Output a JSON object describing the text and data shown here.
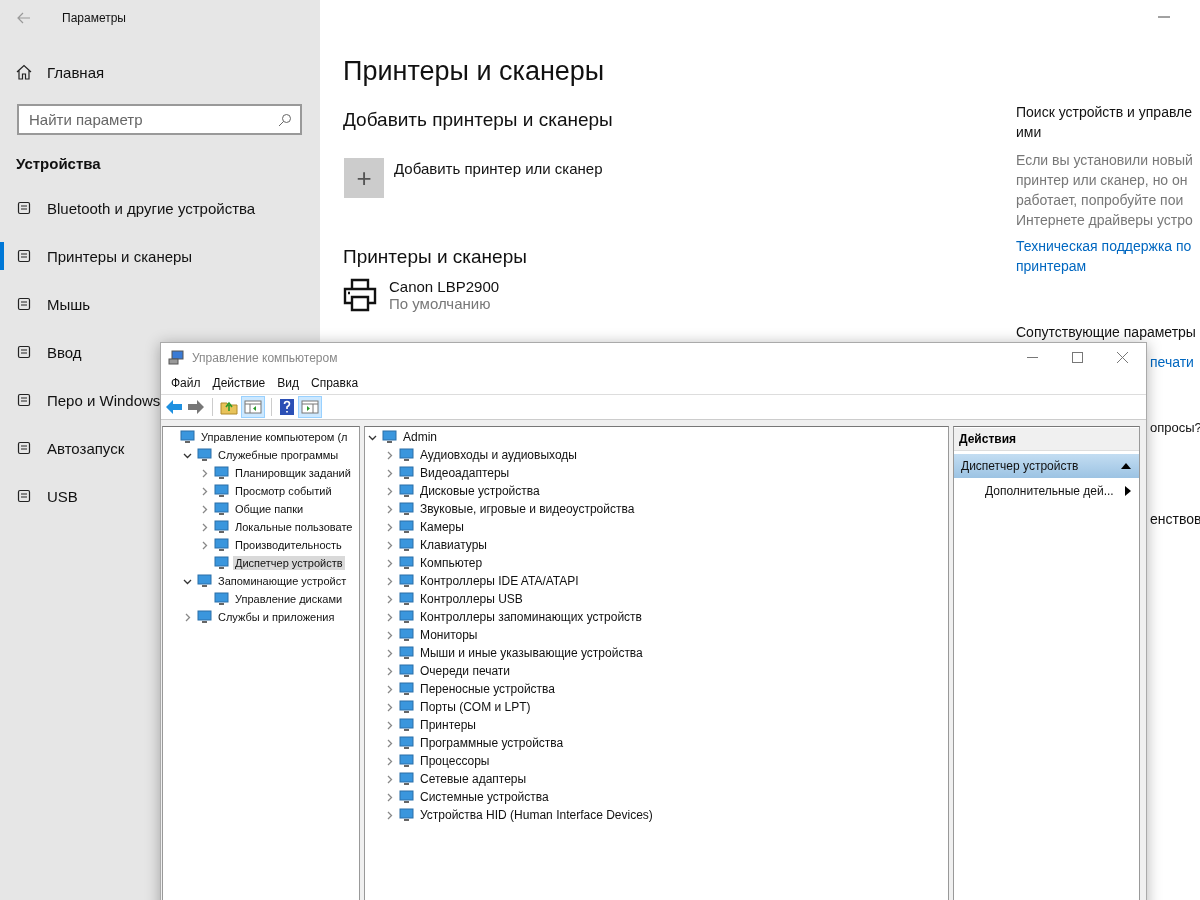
{
  "settings": {
    "title": "Параметры",
    "home": "Главная",
    "search": {
      "placeholder": "Найти параметр"
    },
    "section": "Устройства",
    "nav": [
      {
        "label": "Bluetooth и другие устройства",
        "selected": false
      },
      {
        "label": "Принтеры и сканеры",
        "selected": true
      },
      {
        "label": "Мышь",
        "selected": false
      },
      {
        "label": "Ввод",
        "selected": false
      },
      {
        "label": "Перо и Windows",
        "selected": false
      },
      {
        "label": "Автозапуск",
        "selected": false
      },
      {
        "label": "USB",
        "selected": false
      }
    ],
    "main": {
      "title": "Принтеры и сканеры",
      "add_heading": "Добавить принтеры и сканеры",
      "add_button": "+",
      "add_label": "Добавить принтер или сканер",
      "list_heading": "Принтеры и сканеры",
      "printers": [
        {
          "name": "Canon LBP2900",
          "status": "По умолчанию"
        }
      ]
    },
    "related": {
      "heading_lines": [
        "Поиск устройств и управле",
        "ими"
      ],
      "text_lines": [
        "Если вы установили новый",
        "принтер или сканер, но он",
        "работает, попробуйте пои",
        "Интернете драйверы устро"
      ],
      "link_lines": [
        "Техническая поддержка по",
        "принтерам"
      ],
      "related_heading": "Сопутствующие параметры",
      "peek_link": "печати",
      "peek_question": "опросы?",
      "peek_text": "енствов"
    }
  },
  "mmc": {
    "title": "Управление компьютером",
    "menu": [
      "Файл",
      "Действие",
      "Вид",
      "Справка"
    ],
    "tree": [
      {
        "label": "Управление компьютером (л",
        "selected": false,
        "children": [
          {
            "label": "Служебные программы",
            "expanded": true,
            "selected": false,
            "children": [
              {
                "label": "Планировщик заданий",
                "expanded": false,
                "selected": false
              },
              {
                "label": "Просмотр событий",
                "expanded": false,
                "selected": false
              },
              {
                "label": "Общие папки",
                "expanded": false,
                "selected": false
              },
              {
                "label": "Локальные пользовате",
                "expanded": false,
                "selected": false
              },
              {
                "label": "Производительность",
                "expanded": false,
                "selected": false
              },
              {
                "label": "Диспетчер устройств",
                "selected": true
              }
            ]
          },
          {
            "label": "Запоминающие устройст",
            "expanded": true,
            "selected": false,
            "children": [
              {
                "label": "Управление дисками",
                "selected": false
              }
            ]
          },
          {
            "label": "Службы и приложения",
            "expanded": false,
            "selected": false
          }
        ]
      }
    ],
    "devices": [
      {
        "label": "Admin",
        "expanded": true,
        "selected": false,
        "children": [
          {
            "label": "Аудиовходы и аудиовыходы",
            "expanded": false,
            "selected": false
          },
          {
            "label": "Видеоадаптеры",
            "expanded": false,
            "selected": false
          },
          {
            "label": "Дисковые устройства",
            "expanded": false,
            "selected": false
          },
          {
            "label": "Звуковые, игровые и видеоустройства",
            "expanded": false,
            "selected": false
          },
          {
            "label": "Камеры",
            "expanded": false,
            "selected": false
          },
          {
            "label": "Клавиатуры",
            "expanded": false,
            "selected": false
          },
          {
            "label": "Компьютер",
            "expanded": false,
            "selected": false
          },
          {
            "label": "Контроллеры IDE ATA/ATAPI",
            "expanded": false,
            "selected": false
          },
          {
            "label": "Контроллеры USB",
            "expanded": false,
            "selected": false
          },
          {
            "label": "Контроллеры запоминающих устройств",
            "expanded": false,
            "selected": false
          },
          {
            "label": "Мониторы",
            "expanded": false,
            "selected": false
          },
          {
            "label": "Мыши и иные указывающие устройства",
            "expanded": false,
            "selected": false
          },
          {
            "label": "Очереди печати",
            "expanded": false,
            "selected": false
          },
          {
            "label": "Переносные устройства",
            "expanded": false,
            "selected": false
          },
          {
            "label": "Порты (COM и LPT)",
            "expanded": false,
            "selected": false
          },
          {
            "label": "Принтеры",
            "expanded": false,
            "selected": false
          },
          {
            "label": "Программные устройства",
            "expanded": false,
            "selected": false
          },
          {
            "label": "Процессоры",
            "expanded": false,
            "selected": false
          },
          {
            "label": "Сетевые адаптеры",
            "expanded": false,
            "selected": false
          },
          {
            "label": "Системные устройства",
            "expanded": false,
            "selected": false
          },
          {
            "label": "Устройства HID (Human Interface Devices)",
            "expanded": false,
            "selected": false
          }
        ]
      }
    ],
    "actions": {
      "heading": "Действия",
      "sections": [
        {
          "label": "Диспетчер устройств",
          "expanded": true,
          "items": [
            "Дополнительные дей..."
          ]
        }
      ]
    }
  }
}
